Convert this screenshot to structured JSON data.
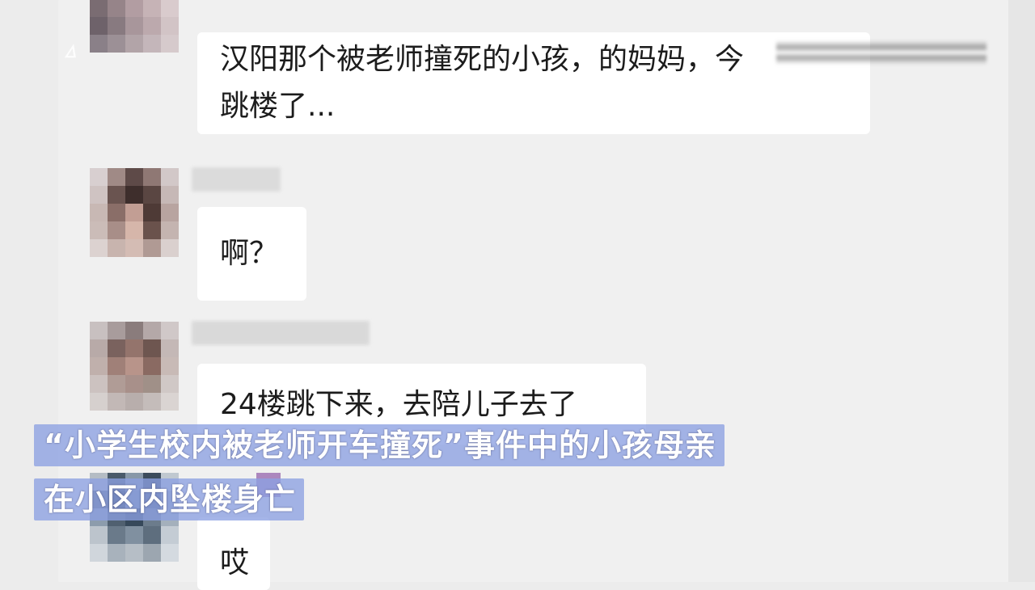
{
  "watermark": "ㅿ",
  "messages": [
    {
      "text_lines": [
        "汉阳那个被老师撞死的小孩，的妈妈，今",
        "跳楼了..."
      ]
    },
    {
      "text_lines": [
        "啊？"
      ]
    },
    {
      "text_lines": [
        "24楼跳下来，去陪儿子去了"
      ]
    },
    {
      "text_lines": [
        "哎"
      ]
    }
  ],
  "captions": [
    "“小学生校内被老师开车撞死”事件中的小孩母亲",
    "在小区内坠楼身亡"
  ],
  "colors": {
    "background": "#f0f0f0",
    "bubble": "#ffffff",
    "text": "#1c1c1c",
    "caption_background": "#8ca0e1",
    "caption_text": "#ffffff"
  }
}
